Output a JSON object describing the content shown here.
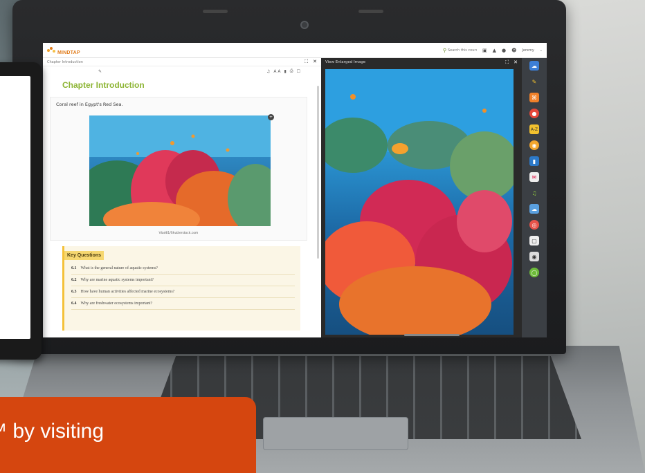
{
  "app": {
    "logo_text": "MINDTAP",
    "search_placeholder": "Search this course",
    "user_name": "Jeremy"
  },
  "left_pane": {
    "header": "Chapter Introduction",
    "chapter_title": "Chapter Introduction",
    "figure_caption": "Coral reef in Egypt's Red Sea.",
    "figure_credit": "Vlad61/Shutterstock.com",
    "key_questions": {
      "heading": "Key Questions",
      "items": [
        {
          "num": "6.1",
          "text": "What is the general nature of aquatic systems?"
        },
        {
          "num": "6.2",
          "text": "Why are marine aquatic systems important?"
        },
        {
          "num": "6.3",
          "text": "How have human activities affected marine ecosystems?"
        },
        {
          "num": "6.4",
          "text": "Why are freshwater ecosystems important?"
        }
      ]
    }
  },
  "right_pane": {
    "header": "View Enlarged Image"
  },
  "banner": {
    "text": "™ by visiting"
  },
  "colors": {
    "brand_orange": "#e07b1a",
    "title_green": "#8db534",
    "banner": "#d5460f",
    "keyq_yellow": "#f6d770"
  }
}
